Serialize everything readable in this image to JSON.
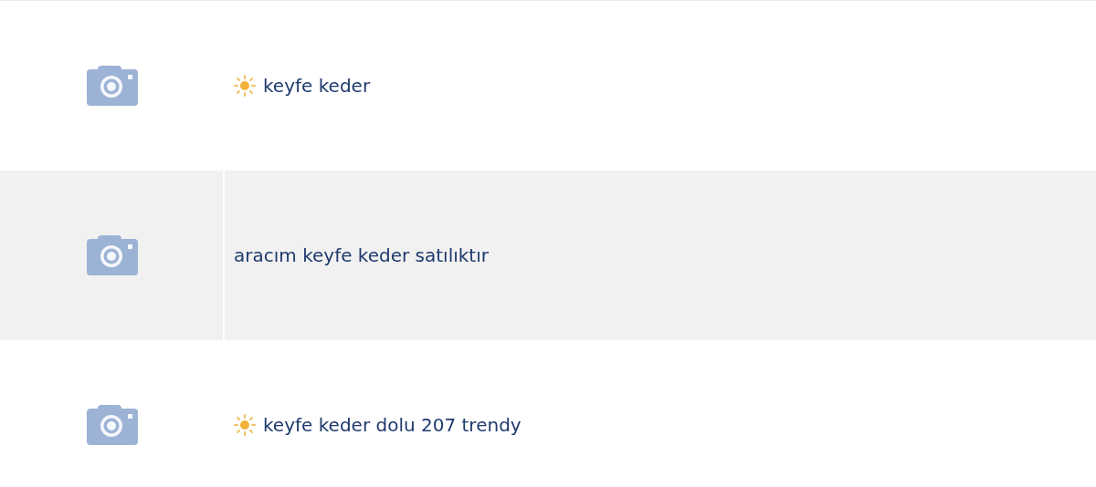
{
  "listings": [
    {
      "title": "keyfe keder",
      "featured": true
    },
    {
      "title": "aracım keyfe keder satılıktır",
      "featured": false
    },
    {
      "title": "keyfe keder dolu 207 trendy",
      "featured": true
    }
  ]
}
